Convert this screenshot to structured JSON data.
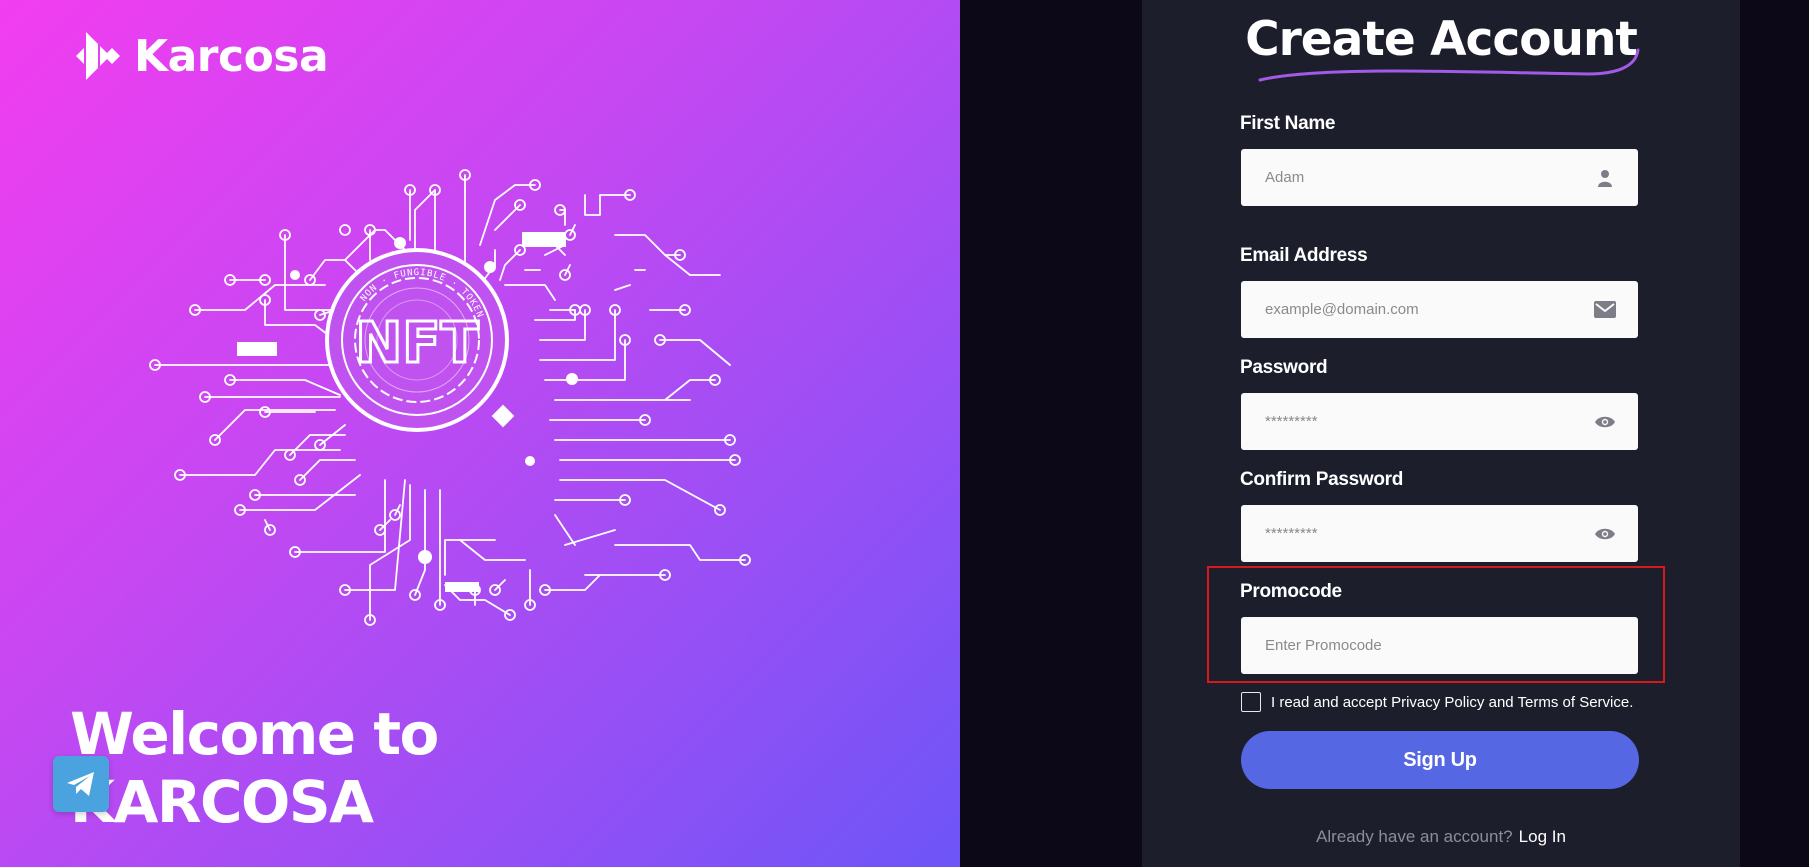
{
  "hero": {
    "brand": "Karcosa",
    "nft_ring_text": "NON · FUNGIBLE · TOKEN",
    "nft_center": "NFT",
    "welcome_line1": "Welcome to",
    "welcome_line2": "KARCOSA"
  },
  "form": {
    "title": "Create Account",
    "first_name": {
      "label": "First Name",
      "placeholder": "Adam",
      "icon": "user-icon"
    },
    "email": {
      "label": "Email Address",
      "placeholder": "example@domain.com",
      "icon": "envelope-icon"
    },
    "password": {
      "label": "Password",
      "placeholder": "*********",
      "icon": "eye-icon"
    },
    "confirm_password": {
      "label": "Confirm Password",
      "placeholder": "*********",
      "icon": "eye-icon"
    },
    "promocode": {
      "label": "Promocode",
      "placeholder": "Enter Promocode"
    },
    "terms_text": "I read and accept Privacy Policy and Terms of Service.",
    "signup_label": "Sign Up",
    "already_text": "Already have an account?",
    "login_label": "Log In"
  },
  "colors": {
    "hero_gradient_start": "#f23df0",
    "hero_gradient_end": "#6d55f7",
    "card_bg": "#1d1e2b",
    "page_bg": "#0d0818",
    "button": "#5567e2",
    "highlight": "#d81919"
  }
}
